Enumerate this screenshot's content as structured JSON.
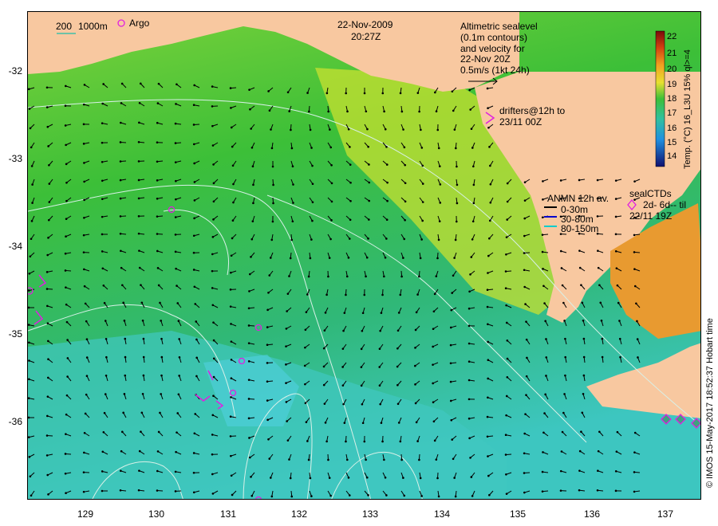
{
  "map": {
    "date": "22-Nov-2009",
    "time": "20:27Z",
    "scale_bar": {
      "label_200": "200",
      "label_1000": "1000m"
    },
    "argo_label": "Argo",
    "altimetry_note": [
      "Altimetric sealevel",
      "(0.1m contours)",
      "and velocity for",
      "22-Nov 20Z",
      "0.5m/s (1kt 24h)"
    ],
    "drifters_note": [
      "drifters@12h to",
      "23/11 00Z"
    ],
    "drifter_symbol": ">",
    "anmn_title": "ANMN 12h av.",
    "anmn_items": [
      {
        "label": "0-30m",
        "color": "#000000"
      },
      {
        "label": "30-80m",
        "color": "#0000cc"
      },
      {
        "label": "80-150m",
        "color": "#00cccc"
      }
    ],
    "seal_title": "sealCTDs",
    "seal_line1": "2d- 6d-- til",
    "seal_line2": "22/11 19Z",
    "colorbar_title": "Temp. (°C) 16_L3U 15% ql>=4",
    "colorbar_ticks": [
      "22",
      "21",
      "20",
      "19",
      "18",
      "17",
      "16",
      "15",
      "14"
    ],
    "credit": "© IMOS 15-May-2017 18:52:37 Hobart time",
    "y_ticks": [
      "-32",
      "-33",
      "-34",
      "-35",
      "-36"
    ],
    "x_ticks": [
      "129",
      "130",
      "131",
      "132",
      "133",
      "134",
      "135",
      "136",
      "137"
    ]
  },
  "colors": {
    "land": "#f8c8a0",
    "warm_sst": "#e89a30",
    "mid_sst": "#3cbf38",
    "cool_sst": "#40c0a8",
    "argo": "#e020e0",
    "contour": "#d8f0e8"
  }
}
